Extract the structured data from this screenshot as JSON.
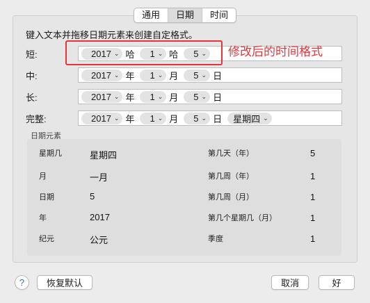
{
  "tabs": [
    "通用",
    "日期",
    "时间"
  ],
  "instructions": "键入文本并拖移日期元素来创建自定格式。",
  "annotation": "修改后的时间格式",
  "formats": {
    "short": {
      "label": "短:",
      "year": "2017",
      "sep1": "哈",
      "month": "1",
      "sep2": "哈",
      "day": "5"
    },
    "medium": {
      "label": "中:",
      "year": "2017",
      "sep1": "年",
      "month": "1",
      "sep2": "月",
      "day": "5",
      "sep3": "日"
    },
    "long": {
      "label": "长:",
      "year": "2017",
      "sep1": "年",
      "month": "1",
      "sep2": "月",
      "day": "5",
      "sep3": "日"
    },
    "full": {
      "label": "完整:",
      "year": "2017",
      "sep1": "年",
      "month": "1",
      "sep2": "月",
      "day": "5",
      "sep3": "日",
      "weekday": "星期四"
    }
  },
  "elements": {
    "title": "日期元素",
    "left": [
      {
        "label": "星期几",
        "value": "星期四"
      },
      {
        "label": "月",
        "value": "一月"
      },
      {
        "label": "日期",
        "value": "5"
      },
      {
        "label": "年",
        "value": "2017"
      },
      {
        "label": "纪元",
        "value": "公元"
      }
    ],
    "right": [
      {
        "label": "第几天（年）",
        "value": "5"
      },
      {
        "label": "第几周（年）",
        "value": "1"
      },
      {
        "label": "第几周（月）",
        "value": "1"
      },
      {
        "label": "第几个星期几（月）",
        "value": "1"
      },
      {
        "label": "季度",
        "value": "1"
      }
    ]
  },
  "buttons": {
    "help": "?",
    "restore": "恢复默认",
    "cancel": "取消",
    "ok": "好"
  },
  "colors": {
    "annotation": "#e8333a"
  }
}
